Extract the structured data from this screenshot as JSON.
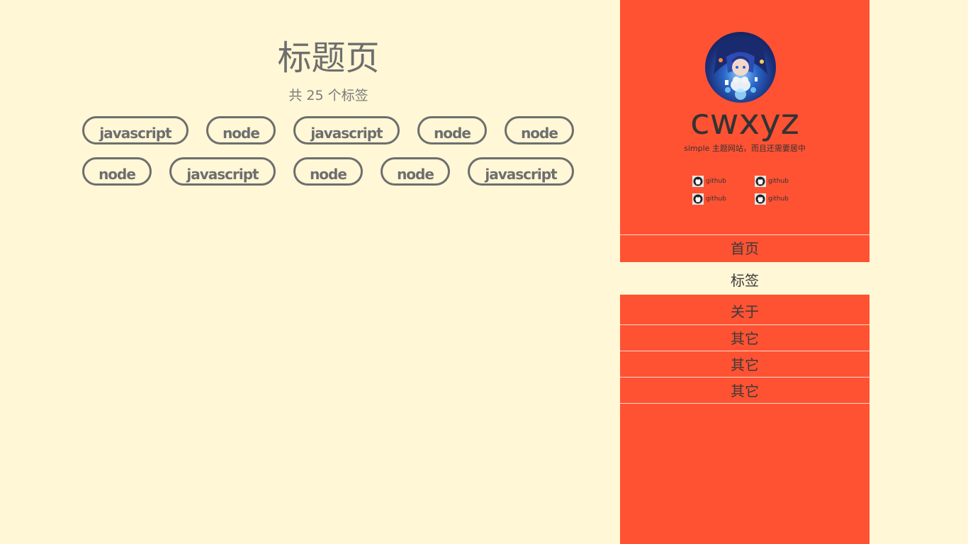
{
  "page": {
    "title": "标题页",
    "subtitle": "共 25 个标签"
  },
  "tags": {
    "row1": [
      "javascript",
      "node",
      "javascript",
      "node",
      "node"
    ],
    "row2": [
      "node",
      "javascript",
      "node",
      "node",
      "javascript"
    ]
  },
  "sidebar": {
    "avatar_icon": "avatar-anime-character",
    "site_name": "cwxyz",
    "description": "simple 主题网站，而且还需要居中",
    "social": [
      {
        "label": "github",
        "icon": "github-icon"
      },
      {
        "label": "github",
        "icon": "github-icon"
      },
      {
        "label": "github",
        "icon": "github-icon"
      },
      {
        "label": "github",
        "icon": "github-icon"
      }
    ],
    "nav": [
      {
        "label": "首页",
        "active": false
      },
      {
        "label": "标签",
        "active": true
      },
      {
        "label": "关于",
        "active": false
      },
      {
        "label": "其它",
        "active": false
      },
      {
        "label": "其它",
        "active": false
      },
      {
        "label": "其它",
        "active": false
      }
    ]
  },
  "colors": {
    "background": "#fff7d6",
    "sidebar": "#ff5233",
    "text": "#6e6e6e",
    "tag_border": "#6e6e6e"
  }
}
